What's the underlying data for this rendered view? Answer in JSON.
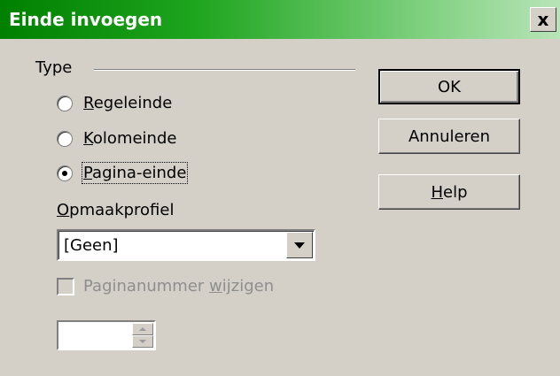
{
  "window": {
    "title": "Einde invoegen",
    "close_label": "x"
  },
  "type_group": {
    "label": "Type",
    "options": [
      {
        "label": "Regeleinde",
        "selected": false
      },
      {
        "label": "Kolomeinde",
        "selected": false
      },
      {
        "label": "Pagina-einde",
        "selected": true
      }
    ]
  },
  "style": {
    "label": "Opmaakprofiel",
    "value": "[Geen]"
  },
  "page_number": {
    "label": "Paginanummer wijzigen",
    "checked": false,
    "enabled": false,
    "value": ""
  },
  "buttons": {
    "ok": "OK",
    "cancel": "Annuleren",
    "help": "Help"
  },
  "colors": {
    "title_gradient_start": "#008000",
    "title_gradient_end": "#b8e4b8",
    "dialog_bg": "#d4d0c8",
    "disabled_text": "#8e8e8e"
  }
}
